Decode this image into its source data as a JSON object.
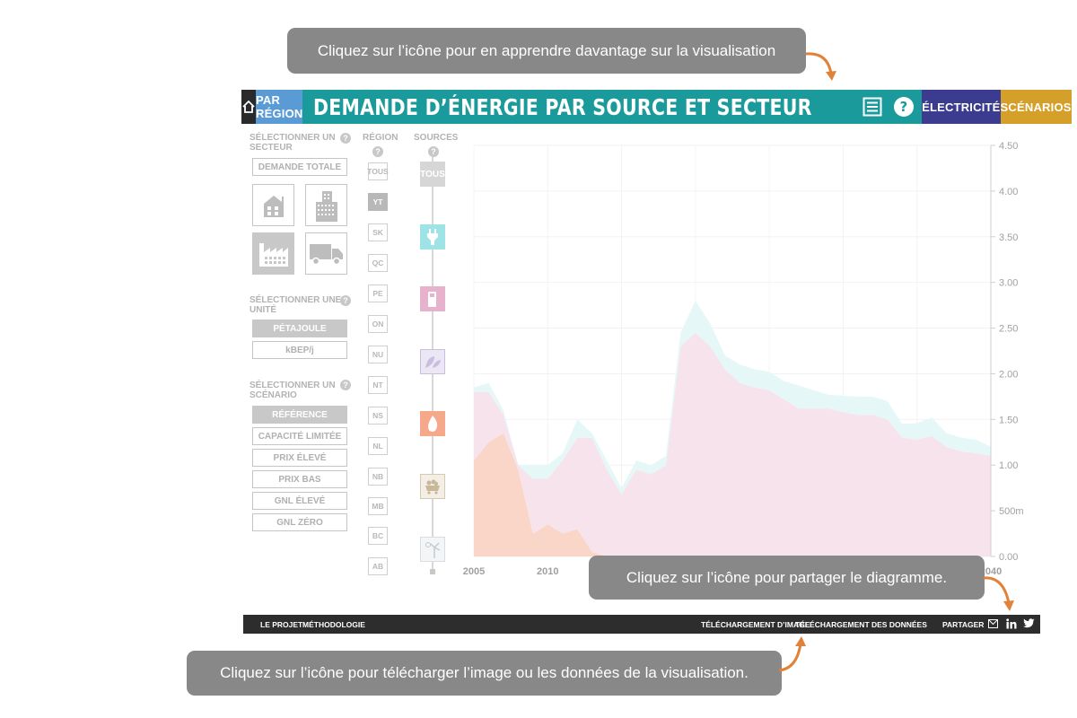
{
  "tooltips": {
    "viz_info": "Cliquez sur l’icône pour en apprendre davantage sur la visualisation",
    "share": "Cliquez sur l’icône pour partager le diagramme.",
    "download": "Cliquez sur l’icône pour télécharger l’image ou les données de la visualisation."
  },
  "header": {
    "by_region": "PAR RÉGION",
    "title": "DEMANDE D’ÉNERGIE PAR SOURCE ET SECTEUR",
    "electricity": "ÉLECTRICITÉ",
    "scenarios": "SCÉNARIOS"
  },
  "sector": {
    "label_line1": "SÉLECTIONNER UN",
    "label_line2": "SECTEUR",
    "total_demand": "DEMANDE TOTALE",
    "icons": [
      "residential-icon",
      "commercial-icon",
      "industrial-icon",
      "transportation-icon"
    ],
    "selected": "industrial"
  },
  "unit": {
    "label_line1": "SÉLECTIONNER UNE",
    "label_line2": "UNITÉ",
    "options": [
      "PÉTAJOULE",
      "kBEP/j"
    ],
    "selected": "PÉTAJOULE"
  },
  "scenario": {
    "label_line1": "SÉLECTIONNER UN",
    "label_line2": "SCÉNARIO",
    "options": [
      "RÉFÉRENCE",
      "CAPACITÉ LIMITÉE",
      "PRIX ÉLEVÉ",
      "PRIX BAS",
      "GNL ÉLEVÉ",
      "GNL ZÉRO"
    ],
    "selected": "RÉFÉRENCE"
  },
  "region": {
    "label": "RÉGION",
    "items": [
      "TOUS",
      "YT",
      "SK",
      "QC",
      "PE",
      "ON",
      "NU",
      "NT",
      "NS",
      "NL",
      "NB",
      "MB",
      "BC",
      "AB"
    ],
    "selected": "YT"
  },
  "sources": {
    "label": "SOURCES",
    "all": "TOUS",
    "icons": [
      "electricity-icon",
      "oil-products-icon",
      "biofuel-icon",
      "natural-gas-icon",
      "coal-icon",
      "renewables-icon"
    ],
    "colors": [
      "#9ee3e6",
      "#e7b3cc",
      "#c9bde0",
      "#f6a88a",
      "#d7c8b0",
      "#d9dde3"
    ]
  },
  "chart_data": {
    "type": "area",
    "x": [
      2005,
      2006,
      2007,
      2008,
      2009,
      2010,
      2011,
      2012,
      2013,
      2014,
      2015,
      2016,
      2017,
      2018,
      2019,
      2020,
      2021,
      2022,
      2023,
      2024,
      2025,
      2026,
      2027,
      2028,
      2029,
      2030,
      2031,
      2032,
      2033,
      2034,
      2035,
      2036,
      2037,
      2038,
      2039,
      2040
    ],
    "series": [
      {
        "values": [
          1.05,
          1.25,
          1.35,
          0.95,
          0.25,
          0.35,
          0.25,
          0.3,
          0.05,
          0,
          0,
          0,
          0,
          0,
          0,
          0,
          0,
          0,
          0,
          0,
          0,
          0,
          0,
          0,
          0,
          0,
          0,
          0,
          0,
          0,
          0,
          0,
          0,
          0,
          0,
          0
        ],
        "color": "#f9d6c8"
      },
      {
        "values": [
          0.75,
          0.55,
          0.2,
          0.05,
          0.6,
          0.5,
          0.8,
          1.0,
          1.25,
          0.95,
          0.68,
          0.95,
          0.9,
          1.0,
          2.3,
          2.45,
          2.3,
          2.05,
          1.9,
          1.85,
          1.82,
          1.72,
          1.62,
          1.62,
          1.62,
          1.58,
          1.55,
          1.55,
          1.5,
          1.3,
          1.28,
          1.32,
          1.2,
          1.15,
          1.13,
          1.1
        ],
        "color": "#f7e3ec"
      },
      {
        "values": [
          0.05,
          0.1,
          0.05,
          0.0,
          0.15,
          0.15,
          0.08,
          0.2,
          0.05,
          0.1,
          0.07,
          0.1,
          0.1,
          0.1,
          0.15,
          0.35,
          0.25,
          0.15,
          0.2,
          0.2,
          0.2,
          0.2,
          0.25,
          0.2,
          0.15,
          0.18,
          0.2,
          0.2,
          0.2,
          0.15,
          0.18,
          0.2,
          0.15,
          0.15,
          0.15,
          0.1
        ],
        "color": "#e6f7f8"
      }
    ],
    "xlim": [
      2005,
      2040
    ],
    "ylim": [
      0,
      4.5
    ],
    "x_ticks": [
      "2005",
      "2010",
      "2040"
    ],
    "y_ticks": [
      "0.00",
      "500m",
      "1.00",
      "1.50",
      "2.00",
      "2.50",
      "3.00",
      "3.50",
      "4.00",
      "4.50"
    ]
  },
  "footer": {
    "project": "LE PROJET",
    "methodology": "MÉTHODOLOGIE",
    "image_download": "TÉLÉCHARGEMENT D’IMAGE",
    "data_download": "TÉLÉCHARGEMENT DES DONNÉES",
    "share": "PARTAGER"
  }
}
